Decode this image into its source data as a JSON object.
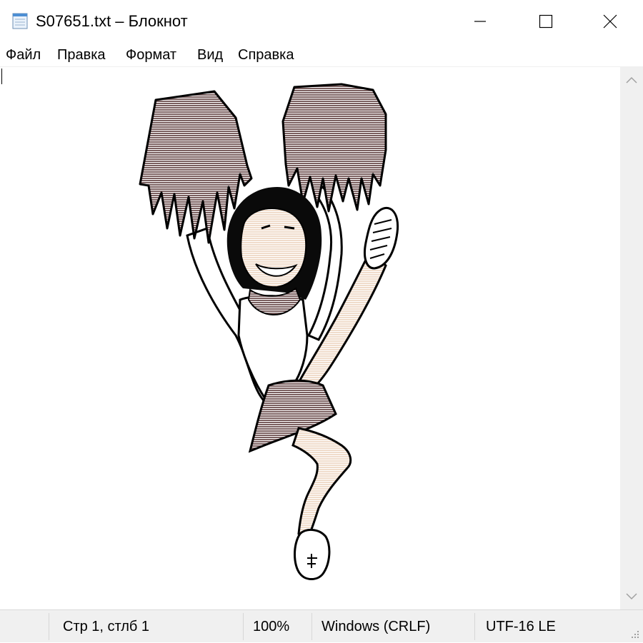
{
  "window": {
    "title": "S07651.txt – Блокнот"
  },
  "menu": {
    "items": [
      "Файл",
      "Правка",
      "Формат",
      "Вид",
      "Справка"
    ]
  },
  "status": {
    "position": "Стр 1, стлб 1",
    "zoom": "100%",
    "line_endings": "Windows (CRLF)",
    "encoding": "UTF-16 LE"
  },
  "colors": {
    "pompom": "#7a5f5f",
    "skin": "#f0dccb",
    "outline": "#000000",
    "statusbar": "#f0f0f0"
  },
  "icons": {
    "app": "notepad-icon",
    "minimize": "minimize-icon",
    "maximize": "maximize-icon",
    "close": "close-icon",
    "scroll_up": "chevron-up-icon",
    "scroll_down": "chevron-down-icon"
  }
}
